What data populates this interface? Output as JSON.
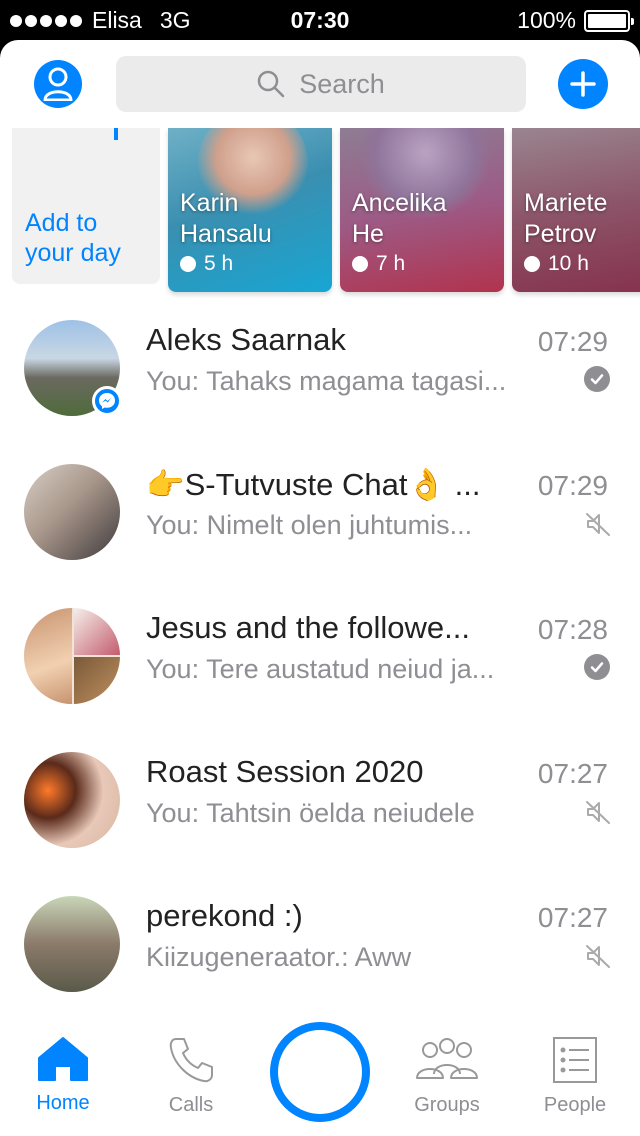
{
  "status_bar": {
    "carrier": "Elisa",
    "network": "3G",
    "time": "07:30",
    "battery": "100%"
  },
  "header": {
    "search_placeholder": "Search"
  },
  "stories": {
    "add_label_line1": "Add to",
    "add_label_line2": "your day",
    "items": [
      {
        "name_line1": "Karin",
        "name_line2": "Hansalu",
        "time": "5 h"
      },
      {
        "name_line1": "Ancelika",
        "name_line2": "He",
        "time": "7 h"
      },
      {
        "name_line1": "Mariete",
        "name_line2": "Petrov",
        "time": "10 h"
      }
    ]
  },
  "chats": [
    {
      "title": "Aleks Saarnak",
      "time": "07:29",
      "preview": "You: Tahaks magama tagasi...",
      "status": "seen"
    },
    {
      "title": "👉S-Tutvuste Chat👌 ...",
      "time": "07:29",
      "preview": "You: Nimelt olen juhtumis...",
      "status": "muted"
    },
    {
      "title": "Jesus and the followe...",
      "time": "07:28",
      "preview": "You: Tere austatud neiud ja...",
      "status": "seen"
    },
    {
      "title": "Roast Session 2020",
      "time": "07:27",
      "preview": "You: Tahtsin öelda neiudele",
      "status": "muted"
    },
    {
      "title": "perekond :)",
      "time": "07:27",
      "preview": "Kiizugeneraator.: Aww",
      "status": "muted"
    }
  ],
  "tabbar": {
    "home": "Home",
    "calls": "Calls",
    "groups": "Groups",
    "people": "People"
  },
  "colors": {
    "accent": "#0084ff",
    "secondary_text": "#8e8e93"
  }
}
